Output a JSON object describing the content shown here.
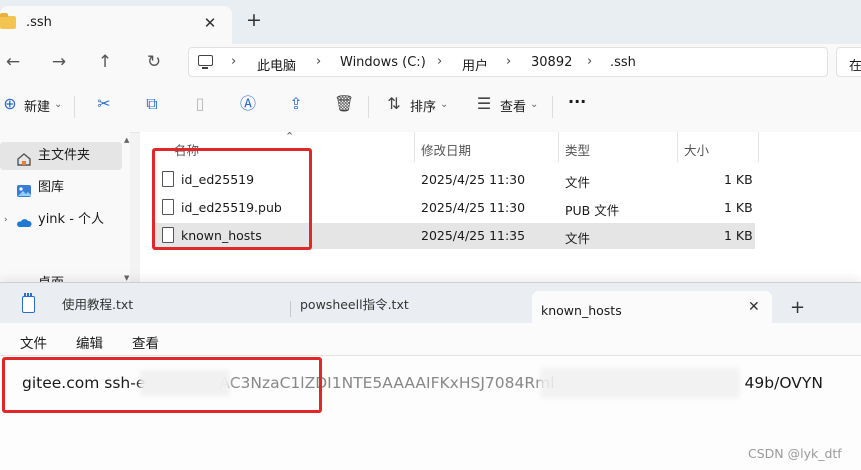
{
  "explorer": {
    "tab_title": ".ssh",
    "close_glyph": "✕",
    "new_tab_glyph": "+",
    "nav": {
      "back": "←",
      "forward": "→",
      "up": "↑",
      "refresh": "↻"
    },
    "breadcrumb": [
      "此电脑",
      "Windows (C:)",
      "用户",
      "30892",
      ".ssh"
    ],
    "search_partial": "在",
    "toolbar": {
      "new_label": "新建",
      "sort_label": "排序",
      "view_label": "查看",
      "more_label": "···"
    },
    "sidebar": [
      {
        "label": "主文件夹",
        "icon": "home-icon"
      },
      {
        "label": "图库",
        "icon": "gallery-icon"
      },
      {
        "label": "yink - 个人",
        "icon": "onedrive-cloud-icon"
      },
      {
        "label": "桌面",
        "icon": "desktop-icon"
      }
    ],
    "columns": [
      "名称",
      "修改日期",
      "类型",
      "大小"
    ],
    "files": [
      {
        "name": "id_ed25519",
        "modified": "2025/4/25 11:30",
        "type": "文件",
        "size": "1 KB"
      },
      {
        "name": "id_ed25519.pub",
        "modified": "2025/4/25 11:30",
        "type": "PUB 文件",
        "size": "1 KB"
      },
      {
        "name": "known_hosts",
        "modified": "2025/4/25 11:35",
        "type": "文件",
        "size": "1 KB"
      }
    ]
  },
  "notepad": {
    "tabs": [
      {
        "label": "使用教程.txt",
        "active": false
      },
      {
        "label": "powsheell指令.txt",
        "active": false
      },
      {
        "label": "known_hosts",
        "active": true
      }
    ],
    "close_glyph": "✕",
    "new_tab_glyph": "+",
    "menu": [
      "文件",
      "编辑",
      "查看"
    ],
    "content": {
      "visible_start": "gitee.com ssh-e",
      "visible_middle": "AC3NzaC1lZDI1NTE5AAAAIFKxHSJ7084Rml",
      "visible_end": "49b/OVYN"
    }
  },
  "watermark": "CSDN @lyk_dtf",
  "colors": {
    "highlight_red": "#e12727",
    "selected_row": "#e5e5e5",
    "accent_blue": "#2b6ccf"
  }
}
